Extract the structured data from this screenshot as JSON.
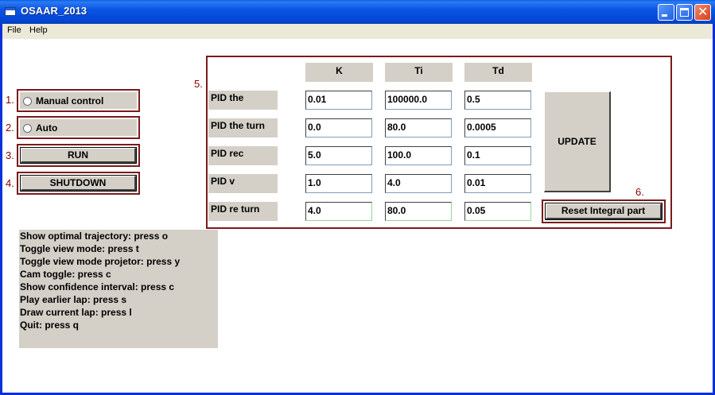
{
  "window": {
    "title": "OSAAR_2013",
    "minimize_icon": "minimize-icon",
    "maximize_icon": "maximize-icon",
    "close_icon": "close-icon"
  },
  "menu": {
    "items": [
      "File",
      "Help"
    ]
  },
  "labels": {
    "n1": "1.",
    "n2": "2.",
    "n3": "3.",
    "n4": "4.",
    "n5": "5.",
    "n6": "6."
  },
  "controls": {
    "manual_label": "Manual control",
    "auto_label": "Auto",
    "run_label": "RUN",
    "shutdown_label": "SHUTDOWN"
  },
  "info_lines": [
    "Show optimal trajectory: press o",
    "Toggle view mode: press t",
    "Toggle view mode projetor: press y",
    "Cam toggle: press c",
    "Show confidence interval: press c",
    "Play earlier lap: press s",
    "Draw current lap: press l",
    "Quit: press q"
  ],
  "pid": {
    "columns": [
      "K",
      "Ti",
      "Td"
    ],
    "rows": [
      {
        "label": "PID the",
        "values": [
          "0.01",
          "100000.0",
          "0.5"
        ]
      },
      {
        "label": "PID the turn",
        "values": [
          "0.0",
          "80.0",
          "0.0005"
        ]
      },
      {
        "label": "PID rec",
        "values": [
          "5.0",
          "100.0",
          "0.1"
        ]
      },
      {
        "label": "PID v",
        "values": [
          "1.0",
          "4.0",
          "0.01"
        ]
      },
      {
        "label": "PID re turn",
        "values": [
          "4.0",
          "80.0",
          "0.05"
        ]
      }
    ],
    "update_label": "UPDATE",
    "reset_label": "Reset Integral part"
  }
}
